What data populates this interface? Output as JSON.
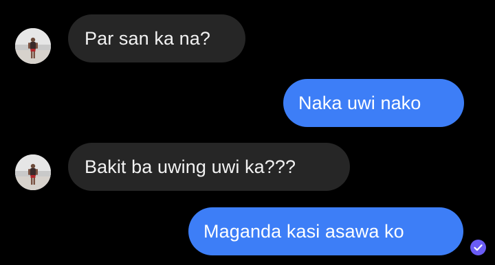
{
  "conversation": {
    "messages": [
      {
        "sender": "contact",
        "text": "Par san ka na?"
      },
      {
        "sender": "me",
        "text": "Naka uwi nako"
      },
      {
        "sender": "contact",
        "text": "Bakit ba uwing uwi ka???"
      },
      {
        "sender": "me",
        "text": "Maganda kasi asawa ko"
      }
    ]
  },
  "colors": {
    "background": "#000000",
    "incoming_bubble": "#262626",
    "outgoing_bubble": "#3d7ef7",
    "read_receipt": "#6a5cf5"
  },
  "icons": {
    "read_receipt": "check-circle-icon",
    "avatar": "contact-avatar"
  }
}
